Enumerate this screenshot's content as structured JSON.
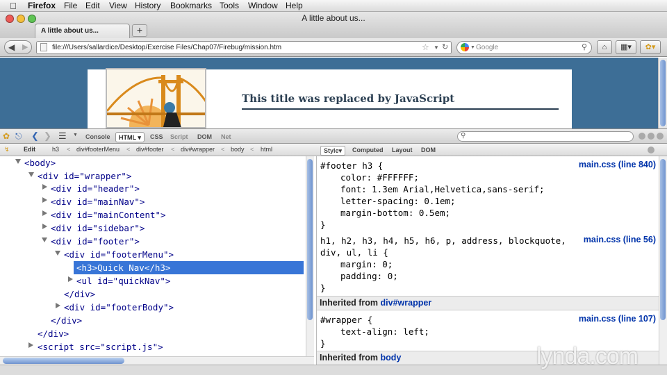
{
  "menubar": {
    "app": "Firefox",
    "items": [
      "File",
      "Edit",
      "View",
      "History",
      "Bookmarks",
      "Tools",
      "Window",
      "Help"
    ]
  },
  "window": {
    "title": "A little about us..."
  },
  "tabs": [
    {
      "label": "A little about us..."
    }
  ],
  "toolbar": {
    "url": "file:///Users/sallardice/Desktop/Exercise Files/Chap07/Firebug/mission.htm",
    "search_placeholder": "Google"
  },
  "page": {
    "heading": "This title was replaced by JavaScript"
  },
  "firebug": {
    "panels": [
      "Console",
      "HTML",
      "CSS",
      "Script",
      "DOM",
      "Net"
    ],
    "active_panel": "HTML",
    "edit_label": "Edit",
    "breadcrumbs": [
      "h3",
      "div#footerMenu",
      "div#footer",
      "div#wrapper",
      "body",
      "html"
    ],
    "side_tabs": [
      "Style",
      "Computed",
      "Layout",
      "DOM"
    ],
    "active_side_tab": "Style"
  },
  "tree": [
    {
      "text": "<body>"
    },
    {
      "text": "<div id=\"wrapper\">"
    },
    {
      "text": "<div id=\"header\">"
    },
    {
      "text": "<div id=\"mainNav\">"
    },
    {
      "text": "<div id=\"mainContent\">"
    },
    {
      "text": "<div id=\"sidebar\">"
    },
    {
      "text": "<div id=\"footer\">"
    },
    {
      "text": "<div id=\"footerMenu\">"
    },
    {
      "text": "<h3>Quick Nav</h3>"
    },
    {
      "text": "<ul id=\"quickNav\">"
    },
    {
      "text": "</div>"
    },
    {
      "text": "<div id=\"footerBody\">"
    },
    {
      "text": "</div>"
    },
    {
      "text": "</div>"
    },
    {
      "text": "<script src=\"script.js\">"
    }
  ],
  "styles": {
    "rule1": {
      "selector": "#footer h3 {",
      "source": "main.css (line 840)",
      "props": [
        "color: #FFFFFF;",
        "font: 1.3em Arial,Helvetica,sans-serif;",
        "letter-spacing: 0.1em;",
        "margin-bottom: 0.5em;"
      ],
      "close": "}"
    },
    "rule2": {
      "selector_line1": "h1, h2, h3, h4, h5, h6, p, address, blockquote,",
      "selector_line2": "div, ul, li {",
      "source": "main.css (line 56)",
      "props": [
        "margin: 0;",
        "padding: 0;"
      ],
      "close": "}"
    },
    "inherited1": {
      "label": "Inherited from",
      "link": "div#wrapper"
    },
    "rule3": {
      "selector": "#wrapper {",
      "source": "main.css (line 107)",
      "props": [
        "text-align: left;"
      ],
      "close": "}"
    },
    "inherited2": {
      "label": "Inherited from",
      "link": "body"
    }
  },
  "watermark": "lynda.com",
  "colors": {
    "selection": "#3875d7",
    "page_bg": "#3d6e96",
    "link": "#0033aa",
    "tag": "#000088",
    "attr_value": "#cc0000"
  }
}
